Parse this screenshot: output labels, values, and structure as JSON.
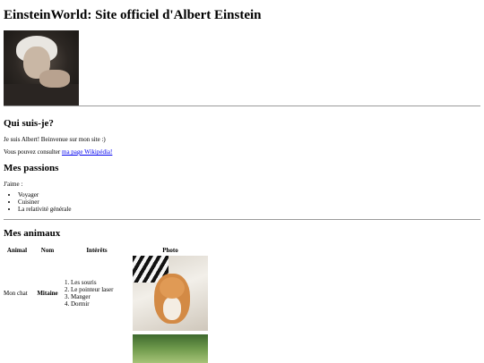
{
  "header": {
    "title": "EinsteinWorld: Site officiel d'Albert Einstein"
  },
  "about": {
    "heading": "Qui suis-je?",
    "intro": "Je suis Albert! Beinvenue sur mon site :)",
    "wiki_prefix": "Vous pouvez consulter ",
    "wiki_link": "ma page Wikipédia!"
  },
  "passions": {
    "heading": "Mes passions",
    "lead": "J'aime :",
    "items": [
      "Voyager",
      "Cuisiner",
      "La relativité générale"
    ]
  },
  "animals": {
    "heading": "Mes animaux",
    "columns": [
      "Animal",
      "Nom",
      "Intérêts",
      "Photo"
    ],
    "rows": [
      {
        "animal": "Mon chat",
        "name": "Mitaine",
        "interests": [
          "Les souris",
          "Le pointeur laser",
          "Manger",
          "Dormir"
        ]
      }
    ]
  }
}
